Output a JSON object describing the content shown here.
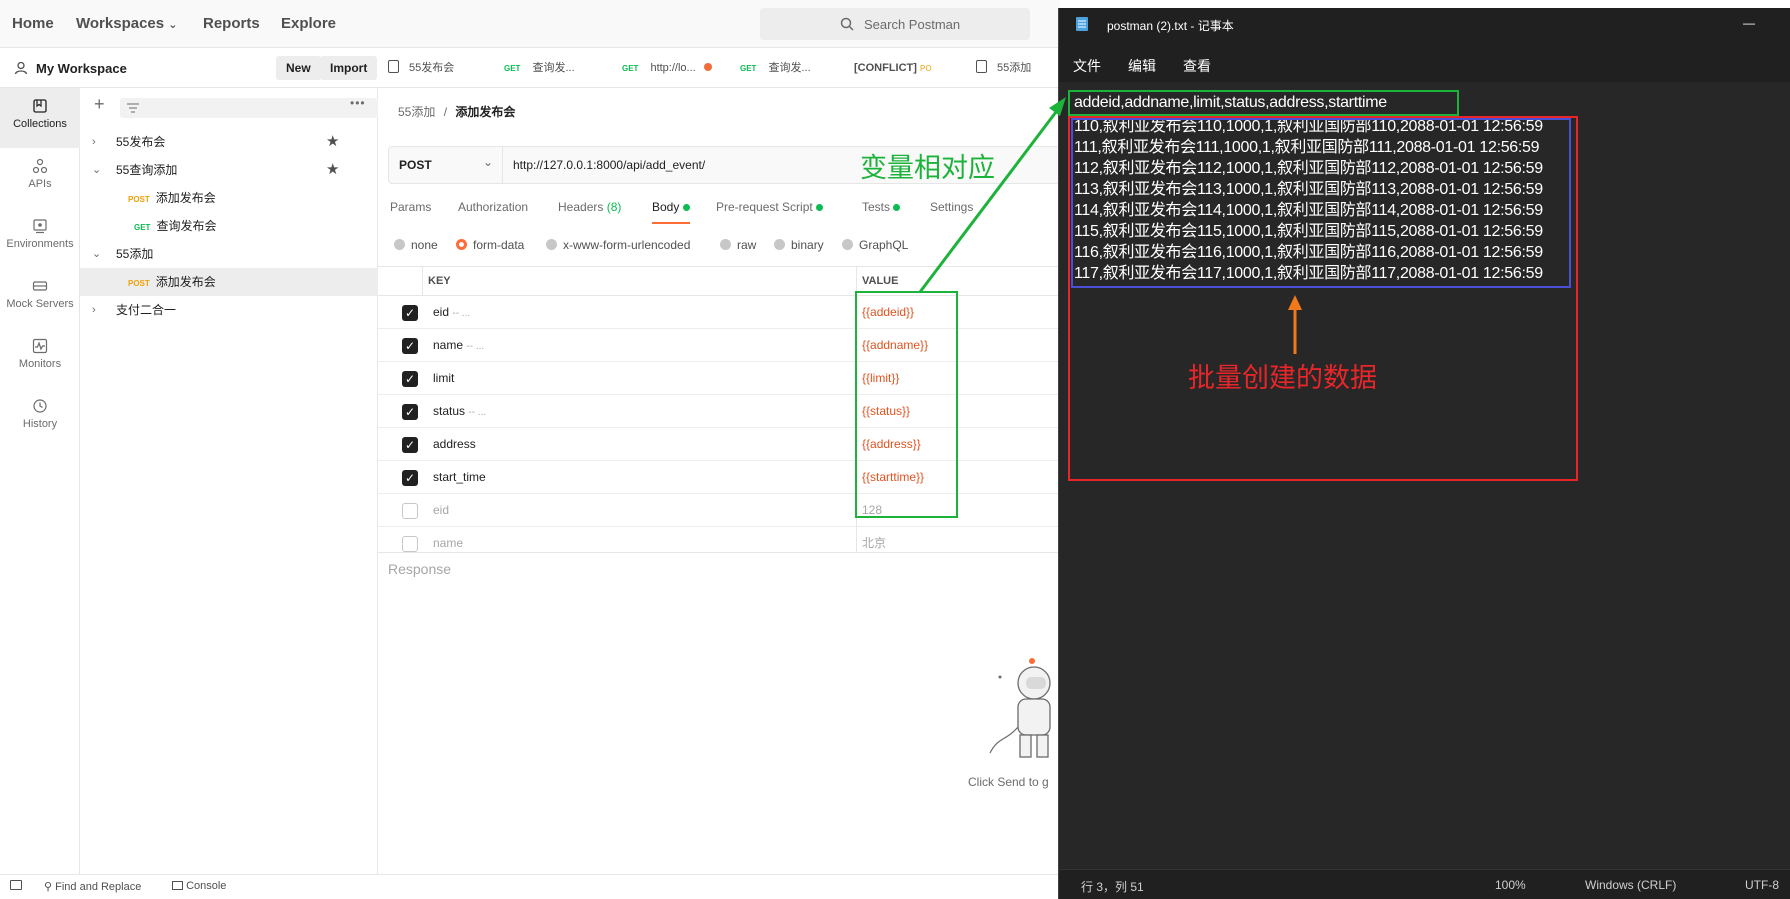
{
  "postman": {
    "topnav": {
      "home": "Home",
      "workspaces": "Workspaces",
      "reports": "Reports",
      "explore": "Explore"
    },
    "search_placeholder": "Search Postman",
    "workspace": {
      "name": "My Workspace",
      "new_label": "New",
      "import_label": "Import"
    },
    "rail": [
      {
        "label": "Collections",
        "icon": "collections-icon"
      },
      {
        "label": "APIs",
        "icon": "apis-icon"
      },
      {
        "label": "Environments",
        "icon": "environments-icon"
      },
      {
        "label": "Mock Servers",
        "icon": "mock-servers-icon"
      },
      {
        "label": "Monitors",
        "icon": "monitors-icon"
      },
      {
        "label": "History",
        "icon": "history-icon"
      }
    ],
    "tree": [
      {
        "label": "55发布会",
        "type": "folder",
        "expanded": false
      },
      {
        "label": "55查询添加",
        "type": "folder",
        "expanded": true
      },
      {
        "label": "添加发布会",
        "method": "POST",
        "type": "request"
      },
      {
        "label": "查询发布会",
        "method": "GET",
        "type": "request"
      },
      {
        "label": "55添加",
        "type": "folder",
        "expanded": true
      },
      {
        "label": "添加发布会",
        "method": "POST",
        "type": "request",
        "selected": true
      },
      {
        "label": "支付二合一",
        "type": "folder",
        "expanded": false
      }
    ],
    "tabs": [
      {
        "label": "55发布会"
      },
      {
        "method": "GET",
        "label": "查询发..."
      },
      {
        "method": "GET",
        "label": "http://lo..."
      },
      {
        "method": "GET",
        "label": "查询发..."
      },
      {
        "label": "[CONFLICT]",
        "badge": "PO"
      },
      {
        "label": "55添加"
      }
    ],
    "breadcrumb": {
      "parent": "55添加",
      "sep": "/",
      "current": "添加发布会"
    },
    "request": {
      "method": "POST",
      "url": "http://127.0.0.1:8000/api/add_event/"
    },
    "reqtabs": {
      "params": "Params",
      "auth": "Authorization",
      "headers": "Headers",
      "headers_count": "(8)",
      "body": "Body",
      "prerequest": "Pre-request Script",
      "tests": "Tests",
      "settings": "Settings"
    },
    "body_types": [
      "none",
      "form-data",
      "x-www-form-urlencoded",
      "raw",
      "binary",
      "GraphQL"
    ],
    "body_selected": "form-data",
    "table": {
      "key_header": "KEY",
      "value_header": "VALUE"
    },
    "rows": [
      {
        "key": "eid",
        "desc": "-- ...",
        "value": "{{addeid}}",
        "checked": true
      },
      {
        "key": "name",
        "desc": "-- ...",
        "value": "{{addname}}",
        "checked": true
      },
      {
        "key": "limit",
        "desc": "",
        "value": "{{limit}}",
        "checked": true
      },
      {
        "key": "status",
        "desc": "-- ...",
        "value": "{{status}}",
        "checked": true
      },
      {
        "key": "address",
        "desc": "",
        "value": "{{address}}",
        "checked": true
      },
      {
        "key": "start_time",
        "desc": "",
        "value": "{{starttime}}",
        "checked": true
      },
      {
        "key": "eid",
        "desc": "",
        "value": "128",
        "checked": false
      },
      {
        "key": "name",
        "desc": "",
        "value": "北京",
        "checked": false
      }
    ],
    "response_label": "Response",
    "click_send": "Click Send to g",
    "statusbar": {
      "find": "Find and Replace",
      "console": "Console"
    }
  },
  "notepad": {
    "title": "postman (2).txt - 记事本",
    "menu": [
      "文件",
      "编辑",
      "查看"
    ],
    "header_line": "addeid,addname,limit,status,address,starttime",
    "lines": [
      "110,叙利亚发布会110,1000,1,叙利亚国防部110,2088-01-01 12:56:59",
      "111,叙利亚发布会111,1000,1,叙利亚国防部111,2088-01-01 12:56:59",
      "112,叙利亚发布会112,1000,1,叙利亚国防部112,2088-01-01 12:56:59",
      "113,叙利亚发布会113,1000,1,叙利亚国防部113,2088-01-01 12:56:59",
      "114,叙利亚发布会114,1000,1,叙利亚国防部114,2088-01-01 12:56:59",
      "115,叙利亚发布会115,1000,1,叙利亚国防部115,2088-01-01 12:56:59",
      "116,叙利亚发布会116,1000,1,叙利亚国防部116,2088-01-01 12:56:59",
      "117,叙利亚发布会117,1000,1,叙利亚国防部117,2088-01-01 12:56:59"
    ],
    "status": {
      "pos": "行 3，列 51",
      "zoom": "100%",
      "eol": "Windows (CRLF)",
      "enc": "UTF-8"
    }
  },
  "annotations": {
    "green_label": "变量相对应",
    "red_label": "批量创建的数据",
    "colors": {
      "green": "#1db33a",
      "red": "#e8262a",
      "blue": "#4a4fd8",
      "orange": "#f07a1a"
    }
  }
}
